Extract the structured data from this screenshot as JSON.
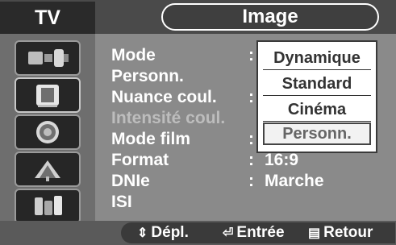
{
  "header": {
    "tv_tab": "TV",
    "title": "Image"
  },
  "sidebar": {
    "items": [
      {
        "icon": "input-icon"
      },
      {
        "icon": "picture-icon"
      },
      {
        "icon": "sound-icon"
      },
      {
        "icon": "channel-icon"
      },
      {
        "icon": "setup-icon"
      }
    ]
  },
  "menu": {
    "rows": [
      {
        "label": "Mode",
        "value": ""
      },
      {
        "label": "Personn.",
        "value": ""
      },
      {
        "label": "Nuance coul.",
        "value": ""
      },
      {
        "label": "Intensité coul.",
        "value": ""
      },
      {
        "label": "Mode film",
        "value": ""
      },
      {
        "label": "Format",
        "value": "16:9"
      },
      {
        "label": "DNIe",
        "value": "Marche"
      },
      {
        "label": "ISI",
        "value": ""
      }
    ],
    "colons": [
      ":",
      ":",
      ":",
      ":",
      ":"
    ]
  },
  "dropdown": {
    "options": [
      "Dynamique",
      "Standard",
      "Cinéma",
      "Personn."
    ],
    "selected": "Personn."
  },
  "footer": {
    "move_label": "Dépl.",
    "enter_label": "Entrée",
    "return_label": "Retour"
  }
}
